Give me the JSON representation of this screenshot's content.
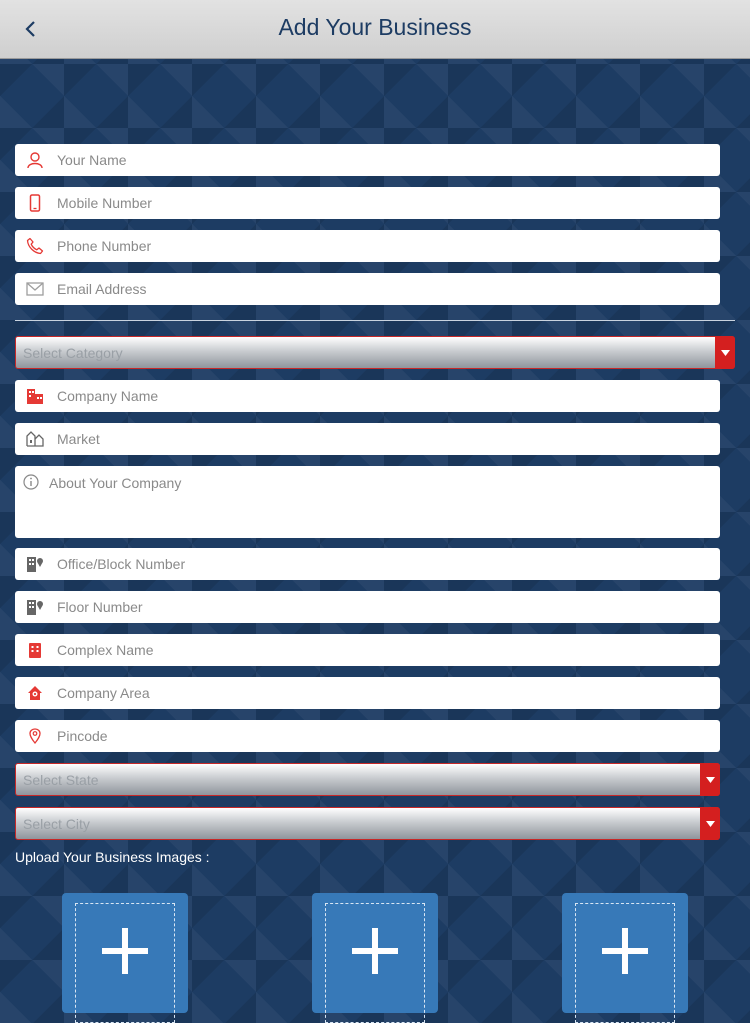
{
  "header": {
    "title": "Add Your Business"
  },
  "contact_fields": [
    {
      "placeholder": "Your Name",
      "icon": "user-icon"
    },
    {
      "placeholder": "Mobile Number",
      "icon": "mobile-icon"
    },
    {
      "placeholder": "Phone Number",
      "icon": "phone-icon"
    },
    {
      "placeholder": "Email Address",
      "icon": "envelope-icon"
    }
  ],
  "business": {
    "category_select": "Select Category",
    "company_name": "Company Name",
    "market": "Market",
    "about": "About Your Company",
    "office_block": "Office/Block Number",
    "floor_number": "Floor Number",
    "complex_name": "Complex Name",
    "company_area": "Company Area",
    "pincode": "Pincode",
    "state_select": "Select State",
    "city_select": "Select City"
  },
  "upload": {
    "label": "Upload Your Business Images :"
  },
  "colors": {
    "accent": "#d41f1f",
    "background": "#1d3c63",
    "header_text": "#1d3c63",
    "upload_tile": "#3779b8"
  }
}
